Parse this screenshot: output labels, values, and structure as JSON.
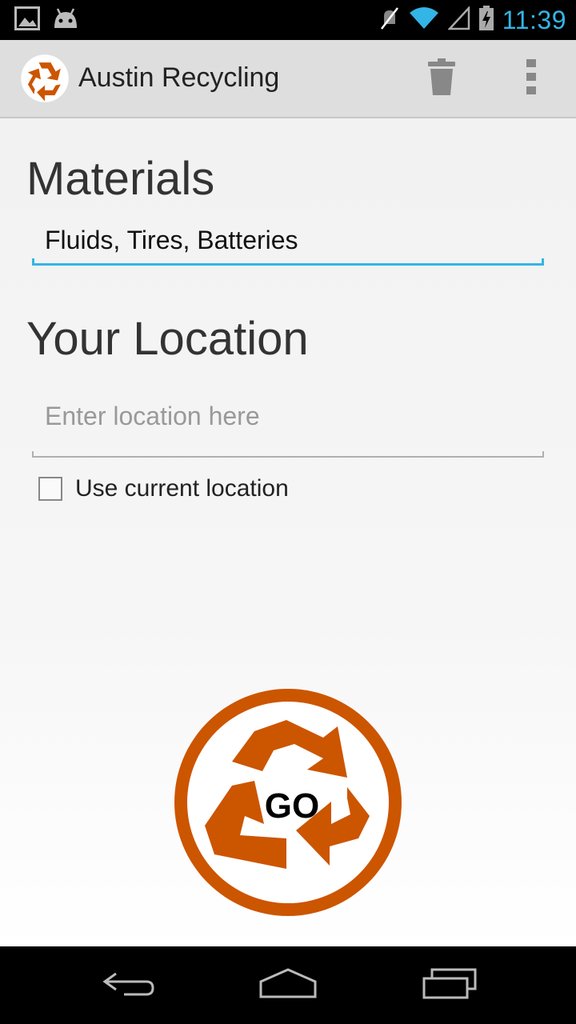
{
  "status_bar": {
    "time": "11:39",
    "icons": [
      "gallery-icon",
      "android-icon",
      "mute-icon",
      "wifi-icon",
      "signal-icon",
      "battery-charging-icon"
    ]
  },
  "action_bar": {
    "title": "Austin Recycling",
    "icons": [
      "recycle-app-icon",
      "trash-icon",
      "overflow-menu-icon"
    ]
  },
  "materials": {
    "heading": "Materials",
    "value": "Fluids, Tires, Batteries"
  },
  "location": {
    "heading": "Your Location",
    "placeholder": "Enter location here",
    "use_current_label": "Use current location",
    "use_current_checked": false
  },
  "go_button": {
    "label": "GO"
  },
  "nav_bar": {
    "icons": [
      "back-icon",
      "home-icon",
      "recents-icon"
    ]
  },
  "colors": {
    "accent": "#33b5e5",
    "recycle_orange": "#cc5500"
  }
}
